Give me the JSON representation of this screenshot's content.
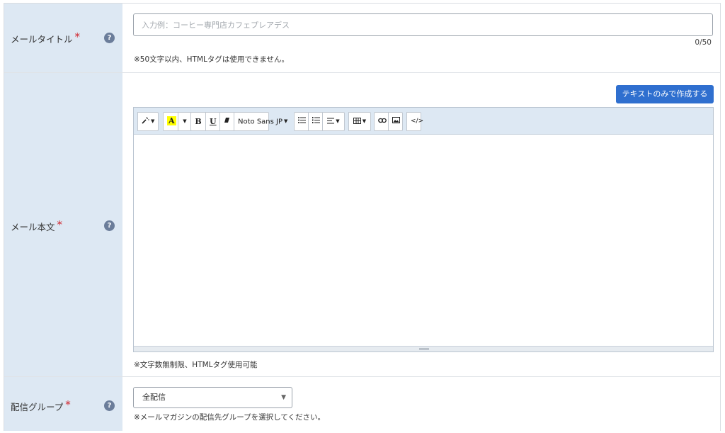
{
  "fields": {
    "title": {
      "label": "メールタイトル",
      "required_mark": "*",
      "help_icon": "?",
      "placeholder": "入力例：コーヒー専門店カフェプレアデス",
      "value": "",
      "counter": "0/50",
      "note": "※50文字以内、HTMLタグは使用できません。"
    },
    "body": {
      "label": "メール本文",
      "required_mark": "*",
      "help_icon": "?",
      "text_only_button": "テキストのみで作成する",
      "font_select": "Noto Sans JP",
      "note": "※文字数無制限、HTMLタグ使用可能"
    },
    "group": {
      "label": "配信グループ",
      "required_mark": "*",
      "help_icon": "?",
      "selected": "全配信",
      "note": "※メールマガジンの配信先グループを選択してください。"
    }
  },
  "toolbar": {
    "style_icon": "magic-wand-icon",
    "highlight_letter": "A",
    "bold_label": "B",
    "underline_label": "U",
    "eraser_icon": "eraser-icon",
    "ul_icon": "unordered-list-icon",
    "ol_icon": "ordered-list-icon",
    "align_icon": "align-icon",
    "table_icon": "table-icon",
    "link_icon": "link-icon",
    "picture_icon": "picture-icon",
    "code_label": "</>"
  },
  "colors": {
    "label_bg": "#dde8f3",
    "required": "#d0262e",
    "primary_button": "#2f6fcf",
    "help_icon": "#6b7d9a",
    "highlight": "#ffff00"
  }
}
